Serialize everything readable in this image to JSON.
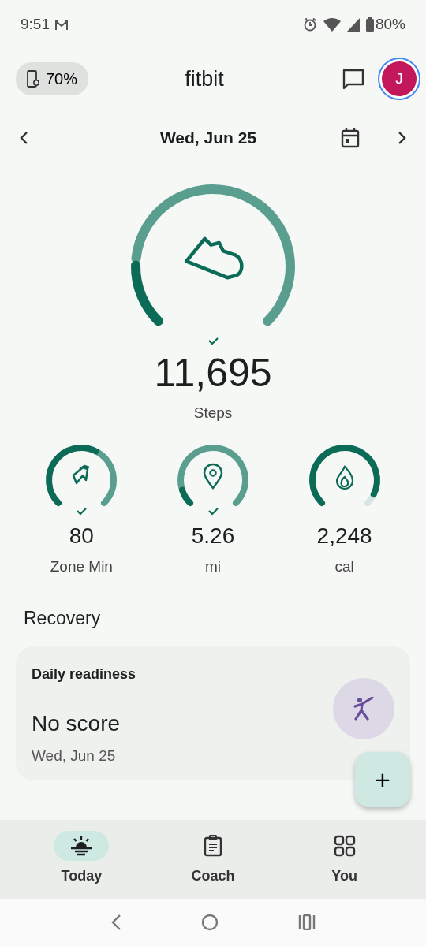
{
  "status_bar": {
    "time": "9:51",
    "battery": "80%"
  },
  "header": {
    "device_battery": "70%",
    "title": "fitbit",
    "avatar_letter": "J"
  },
  "date_nav": {
    "date": "Wed, Jun 25"
  },
  "steps": {
    "value": "11,695",
    "label": "Steps",
    "goal_met": true
  },
  "metrics": [
    {
      "kind": "zone",
      "value": "80",
      "label": "Zone Min",
      "goal_met": true
    },
    {
      "kind": "distance",
      "value": "5.26",
      "label": "mi",
      "goal_met": true
    },
    {
      "kind": "calories",
      "value": "2,248",
      "label": "cal",
      "goal_met": false
    }
  ],
  "recovery": {
    "heading": "Recovery",
    "card_title": "Daily readiness",
    "score": "No score",
    "date": "Wed, Jun 25"
  },
  "fab": "+",
  "nav_items": [
    {
      "kind": "today",
      "label": "Today",
      "selected": true
    },
    {
      "kind": "coach",
      "label": "Coach",
      "selected": false
    },
    {
      "kind": "you",
      "label": "You",
      "selected": false
    }
  ]
}
